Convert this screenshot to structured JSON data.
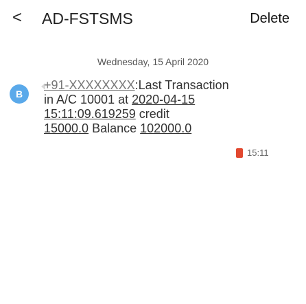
{
  "header": {
    "back_icon": "chevron-left-icon",
    "back_glyph": "<",
    "title": "AD-FSTSMS",
    "delete_label": "Delete"
  },
  "conversation": {
    "date_separator": "Wednesday, 15 April 2020"
  },
  "message": {
    "avatar_letter": "B",
    "avatar_color": "#5aa9ea",
    "sender_prefix": "+91-XXXXXXXX",
    "line1": ":Last Transaction",
    "line2_prefix": "in A/C 10001 at ",
    "line2_date": "2020-04-15",
    "line3_time": "15:11:09.619259",
    "line3_suffix": " credit",
    "line4_amount": "15000.0",
    "line4_middle": " Balance ",
    "line4_balance": "102000.0",
    "sim_icon": "sim-card-icon",
    "sim_color": "#e2482f",
    "time": "15:11"
  }
}
